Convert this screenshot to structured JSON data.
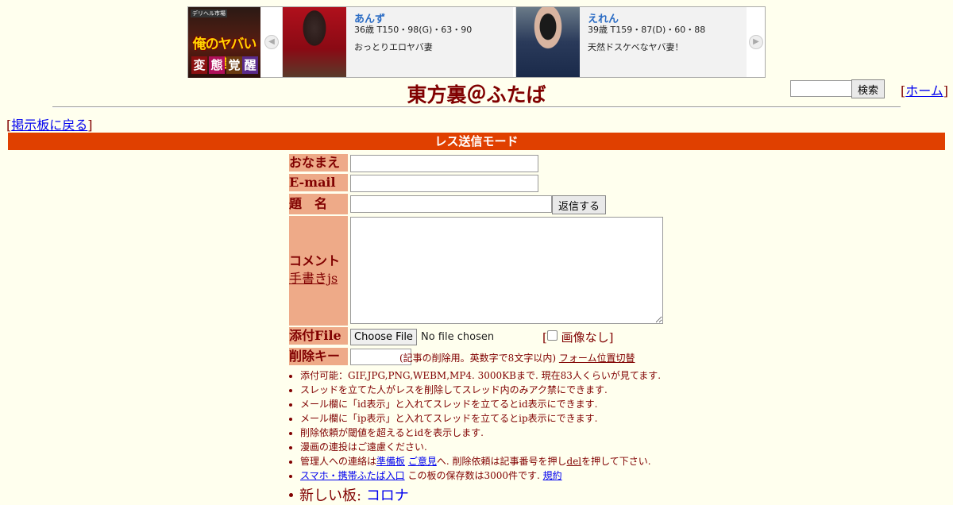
{
  "banner": {
    "logo": {
      "tag": "デリヘル市場",
      "brand": "俺のヤバい妻",
      "badges": [
        "変",
        "態",
        "覚",
        "醒"
      ]
    },
    "cards": [
      {
        "name": "あんず",
        "stats": "36歳 T150・98(G)・63・90",
        "catch": "おっとりエロヤバ妻"
      },
      {
        "name": "えれん",
        "stats": "39歳 T159・87(D)・60・88",
        "catch": "天然ドスケベなヤバ妻！"
      }
    ]
  },
  "header": {
    "title": "東方裏＠ふたば",
    "search_button": "検索",
    "home_link": "ホーム",
    "back_link": "掲示板に戻る"
  },
  "mode_label": "レス送信モード",
  "form": {
    "name_label": "おなまえ",
    "email_label": "E-mail",
    "subject_label": "題　名",
    "submit_label": "返信する",
    "comment_label": "コメント",
    "tegaki_link": "手書きjs",
    "file_label": "添付File",
    "file_button": "Choose File",
    "file_status": "No file chosen",
    "no_image_label": "画像なし",
    "delkey_label": "削除キー",
    "delkey_hint": "(記事の削除用。英数字で8文字以内)",
    "position_link": "フォーム位置切替"
  },
  "rules": {
    "r1": "添付可能：GIF,JPG,PNG,WEBM,MP4. 3000KBまで. 現在83人くらいが見てます.",
    "r2": "スレッドを立てた人がレスを削除してスレッド内のみアク禁にできます.",
    "r3": "メール欄に「id表示」と入れてスレッドを立てるとid表示にできます.",
    "r4": "メール欄に「ip表示」と入れてスレッドを立てるとip表示にできます.",
    "r5": "削除依頼が閾値を超えるとidを表示します.",
    "r6": "漫画の連投はご遠慮ください.",
    "r7_pre": "管理人への連絡は",
    "r7_link1": "準備板",
    "r7_link2": "ご意見",
    "r7_mid": "へ. 削除依頼は記事番号を押し",
    "r7_link3": "del",
    "r7_post": "を押して下さい.",
    "r8_link1": "スマホ・携帯ふたば入口",
    "r8_mid": " この板の保存数は3000件です. ",
    "r8_link2": "規約"
  },
  "new_board": {
    "label": "新しい板:",
    "link": "コロナ"
  }
}
